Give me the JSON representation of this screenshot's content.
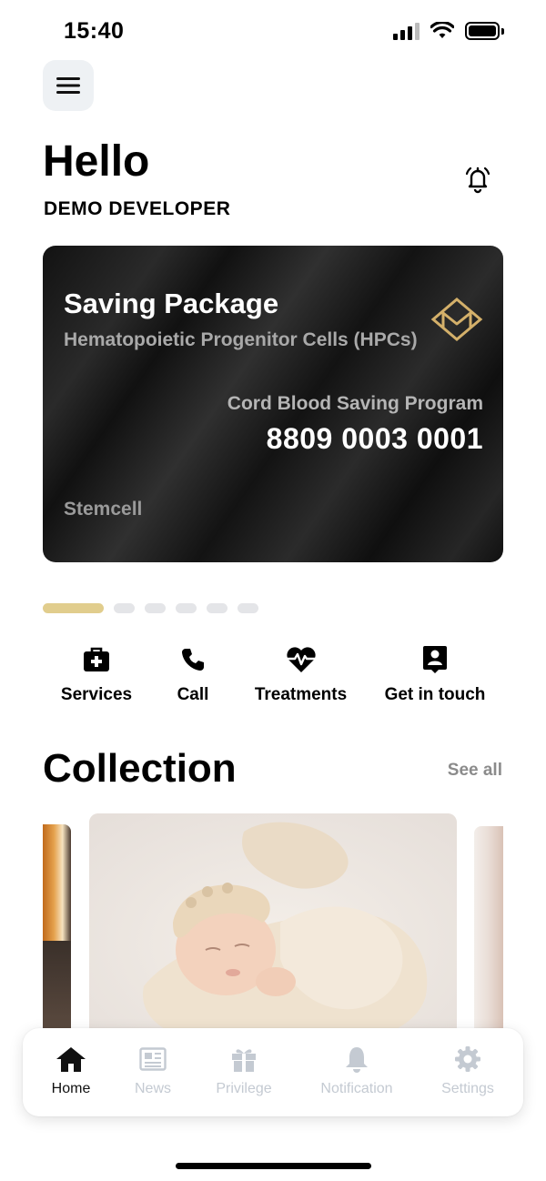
{
  "status_bar": {
    "time": "15:40"
  },
  "header": {
    "greeting": "Hello",
    "user_name": "DEMO DEVELOPER"
  },
  "card": {
    "title": "Saving Package",
    "subtitle": "Hematopoietic Progenitor Cells (HPCs)",
    "program": "Cord Blood Saving Program",
    "number": "8809 0003 0001",
    "brand": "Stemcell",
    "logo_color": "#d4b06a"
  },
  "pager": {
    "total": 6,
    "active": 1
  },
  "actions": [
    {
      "label": "Services",
      "icon": "medical-kit-icon"
    },
    {
      "label": "Call",
      "icon": "phone-icon"
    },
    {
      "label": "Treatments",
      "icon": "heartbeat-icon"
    },
    {
      "label": "Get in touch",
      "icon": "contact-card-icon"
    }
  ],
  "collection": {
    "title": "Collection",
    "see_all": "See all"
  },
  "bottom_nav": [
    {
      "label": "Home",
      "icon": "home-icon",
      "active": true
    },
    {
      "label": "News",
      "icon": "newspaper-icon",
      "active": false
    },
    {
      "label": "Privilege",
      "icon": "gift-icon",
      "active": false
    },
    {
      "label": "Notification",
      "icon": "bell-icon",
      "active": false
    },
    {
      "label": "Settings",
      "icon": "gear-icon",
      "active": false
    }
  ],
  "colors": {
    "accent": "#e1cd8d",
    "inactive_nav": "#c4cad2",
    "card_background": "#151515"
  }
}
